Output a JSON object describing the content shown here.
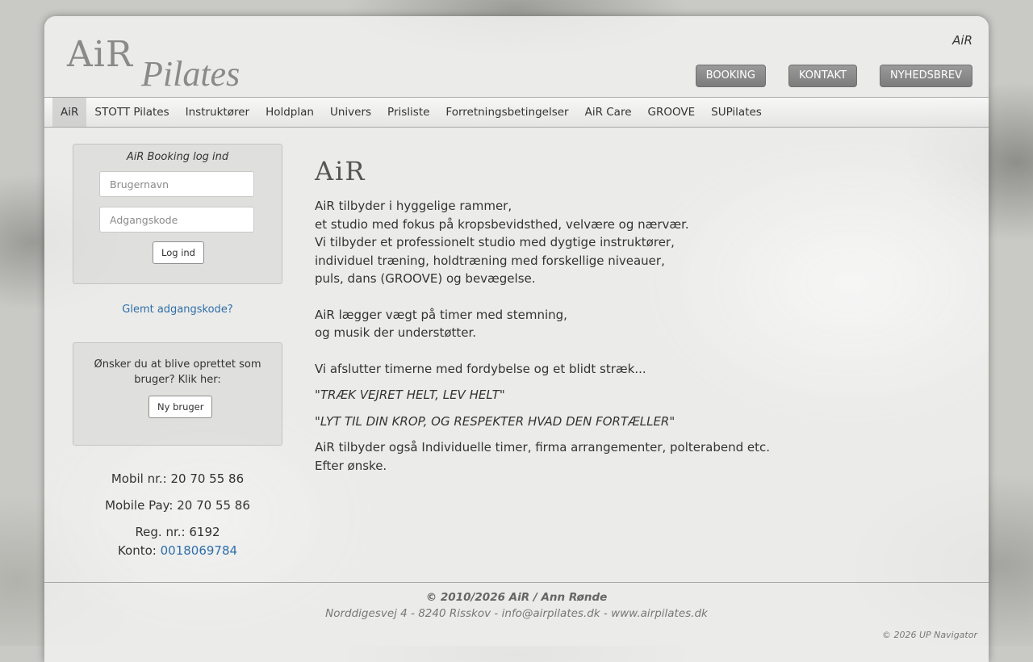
{
  "header": {
    "logo": {
      "top": "AiR",
      "script": "Pilates"
    },
    "site_name": "AiR",
    "buttons": [
      "BOOKING",
      "KONTAKT",
      "NYHEDSBREV"
    ]
  },
  "nav": {
    "items": [
      "AiR",
      "STOTT Pilates",
      "Instruktører",
      "Holdplan",
      "Univers",
      "Prisliste",
      "Forretningsbetingelser",
      "AiR Care",
      "GROOVE",
      "SUPilates"
    ]
  },
  "login": {
    "title": "AiR Booking log ind",
    "username_placeholder": "Brugernavn",
    "password_placeholder": "Adgangskode",
    "login_label": "Log ind",
    "forgot_label": "Glemt adgangskode?"
  },
  "new_user": {
    "text": "Ønsker du at blive oprettet som bruger? Klik her:",
    "button_label": "Ny bruger"
  },
  "contact": {
    "mobile": "Mobil nr.: 20 70 55 86",
    "mobile_pay": "Mobile Pay:  20 70 55 86",
    "reg": "Reg. nr.: 6192",
    "konto_label": "Konto: ",
    "konto_value": "0018069784"
  },
  "content": {
    "title": "AiR",
    "lines1": [
      "AiR tilbyder i hyggelige rammer,",
      "et studio med fokus på kropsbevidsthed, velvære og nærvær.",
      "Vi tilbyder et professionelt studio med dygtige instruktører,",
      "individuel træning, holdtræning med forskellige niveauer,",
      "puls, dans (GROOVE) og bevægelse."
    ],
    "lines2": [
      "AiR lægger vægt på timer med stemning,",
      "og musik der understøtter."
    ],
    "line3": "Vi afslutter timerne med fordybelse og et blidt stræk...",
    "quote1": "\"TRÆK VEJRET HELT, LEV HELT\"",
    "quote2": "\"LYT TIL DIN KROP, OG RESPEKTER HVAD DEN FORTÆLLER\"",
    "lines4": [
      "AiR tilbyder også Individuelle timer, firma arrangementer, polterabend etc.",
      "Efter ønske."
    ]
  },
  "footer": {
    "copyright": "© 2010/2026 AiR / Ann Rønde",
    "address": "Norddigesvej 4 - 8240 Risskov - info@airpilates.dk - www.airpilates.dk",
    "powered_by": "© 2026 UP Navigator"
  }
}
